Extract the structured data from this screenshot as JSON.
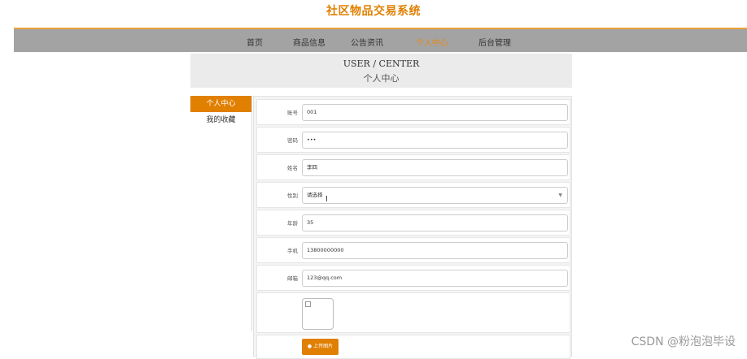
{
  "site": {
    "title": "社区物品交易系统"
  },
  "nav": {
    "items": [
      {
        "label": "首页",
        "active": false
      },
      {
        "label": "商品信息",
        "active": false
      },
      {
        "label": "公告资讯",
        "active": false
      },
      {
        "label": "个人中心",
        "active": true
      },
      {
        "label": "后台管理",
        "active": false
      }
    ]
  },
  "banner": {
    "en": "USER / CENTER",
    "cn": "个人中心"
  },
  "sidebar": {
    "items": [
      {
        "label": "个人中心",
        "active": true
      },
      {
        "label": "我的收藏",
        "active": false
      }
    ]
  },
  "form": {
    "account": {
      "label": "账号",
      "value": "001"
    },
    "password": {
      "label": "密码",
      "value": "•••"
    },
    "name": {
      "label": "姓名",
      "value": "李四"
    },
    "gender": {
      "label": "性别",
      "value": "请选择"
    },
    "age": {
      "label": "年龄",
      "value": "35"
    },
    "phone": {
      "label": "手机",
      "value": "13800000000"
    },
    "email": {
      "label": "邮箱",
      "value": "123@qq.com"
    },
    "upload_label": "上传图片"
  },
  "watermark": "CSDN @粉泡泡毕设",
  "colors": {
    "accent": "#e07f00",
    "navbar": "#a3a3a3"
  }
}
